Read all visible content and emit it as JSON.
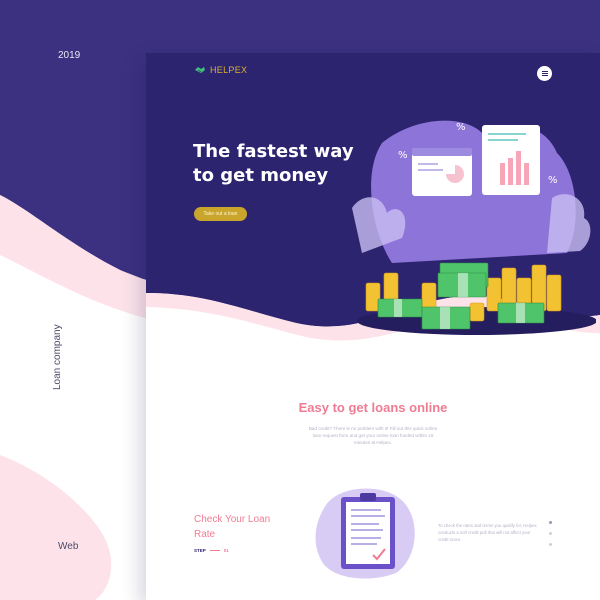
{
  "meta": {
    "year": "2019",
    "category": "Loan company",
    "type": "Web"
  },
  "brand": {
    "name": "HELPEX",
    "color": "#d6b22c"
  },
  "hero": {
    "title": "The fastest way to get money",
    "cta_label": "Take out a loan",
    "background": "#2d2470"
  },
  "menu": {
    "icon": "hamburger-icon"
  },
  "loans_section": {
    "title": "Easy to get loans online",
    "body": "Bad credit? There is no problem with it! Fill out this quick online loan request form and get your online loan funded within 15 minutes at Helpex."
  },
  "rate_section": {
    "title": "Check Your Loan Rate",
    "step_label": "STEP",
    "step_number": "01",
    "body": "To check the rates and terms you qualify for, Helpex conducts a soft credit pull that will not affect your credit score."
  },
  "pagination": {
    "count": 3,
    "active": 1
  },
  "colors": {
    "accent": "#f07c93",
    "pink_bg": "#fde3e9",
    "purple_dark": "#2d2470",
    "purple_light": "#3b3180"
  }
}
